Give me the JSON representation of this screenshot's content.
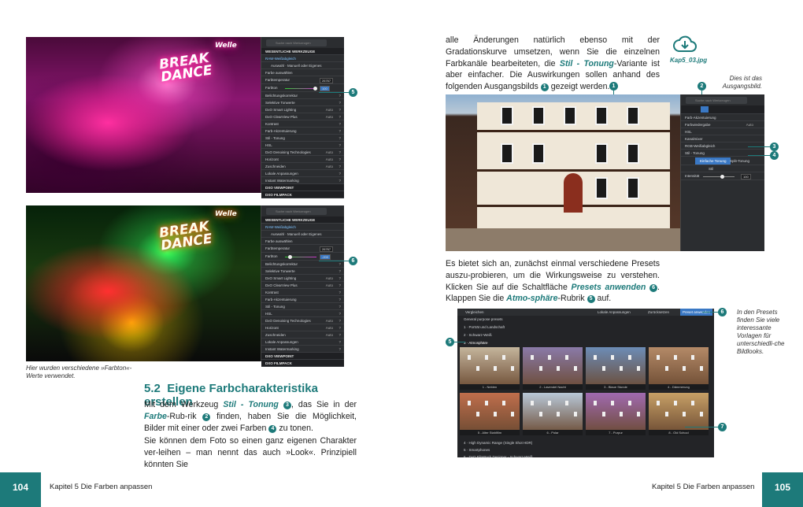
{
  "left_page": {
    "panel": {
      "search_placeholder": "Suche nach Werkzeugen",
      "section": "WESENTLICHE WERKZEUGE",
      "sub": "RAW-Weißabgleich",
      "mode": "Auswahl · Manuell oder Eigenes",
      "pick": "Farbe auswählen",
      "temp_label": "Farbtemperatur",
      "temp_value": "26767",
      "tint_label": "Farbton",
      "tint_value_1": "100",
      "tint_value_2": "-200",
      "tools": [
        "Belichtungskorrektur",
        "Selektive Tonwerte",
        "DxO Smart Lighting",
        "DxO ClearView Plus",
        "Kontrast",
        "Farb-Akzentuierung",
        "Stil - Tonung",
        "HSL",
        "DxO Denoising Technologies",
        "Horizont",
        "Zuschneiden",
        "Lokale Anpassungen",
        "Instant Watermarking"
      ],
      "tool_values": [
        "",
        "",
        "Auto",
        "Auto",
        "",
        "",
        "",
        "",
        "Auto",
        "Auto",
        "Auto",
        "",
        ""
      ],
      "footer1": "DXO VIEWPOINT",
      "footer2": "DXO FILMPACK"
    },
    "photo1_sign": "BREAK DANCE",
    "photo1_sub": "Welle",
    "callout_5": "5",
    "callout_6": "6",
    "caption": "Hier wurden verschiedene »Farbton«-Werte verwendet.",
    "heading_num": "5.2",
    "heading": "Eigene Farbcharakteristika erstellen",
    "para1_a": "Mit dem Werkzeug ",
    "para1_tool": "Stil - Tonung",
    "para1_n1": "3",
    "para1_b": ", das Sie in der ",
    "para1_farbe": "Farbe",
    "para1_c": "-Rub-rik ",
    "para1_n2": "2",
    "para1_d": " finden, haben Sie die Möglichkeit, Bilder mit einer oder zwei Farben ",
    "para1_n3": "4",
    "para1_e": " zu tonen.",
    "para2": "Sie können dem Foto so einen ganz eigenen Charakter ver-leihen – man nennt das auch »Look«. Prinzipiell könnten Sie",
    "page_num": "104",
    "footer_label": "Kapitel 5   Die Farben anpassen"
  },
  "right_page": {
    "para_top_a": "alle Änderungen natürlich ebenso mit der Gradationskurve umsetzen, wenn Sie die einzelnen Farbkanäle bearbeiteten, die ",
    "para_top_tool": "Stil - Tonung",
    "para_top_b": "-Variante ist aber einfacher. Die Auswirkungen sollen anhand des folgenden Ausgangsbilds ",
    "para_top_n1": "1",
    "para_top_c": " gezeigt werden.",
    "download_label": "Kap5_03.jpg",
    "side_caption1": "Dies ist das Ausgangsbild.",
    "house_panel": {
      "rows": [
        "Farb-Akzentuierung",
        "Farbwiedergabe",
        "HSL",
        "Kanalmixer",
        "RGB-Weißabgleich",
        "Stil - Tonung"
      ],
      "row_values": [
        "",
        "Auto",
        "",
        "",
        "",
        ""
      ],
      "tab1": "Einfache Tonung",
      "tab2": "Split-Tonung",
      "stil": "Stil",
      "intensity": "Intensität",
      "intensity_value": "100"
    },
    "callouts_top": [
      "1",
      "2",
      "3",
      "4"
    ],
    "para_mid_a": "Es bietet sich an, zunächst einmal verschiedene Presets auszu-probieren, um die Wirkungsweise zu verstehen. Klicken Sie auf die Schaltfläche ",
    "para_mid_btn": "Presets anwenden",
    "para_mid_n6": "6",
    "para_mid_b": ". Klappen Sie die ",
    "para_mid_cat": "Atmo-sphäre",
    "para_mid_c": "-Rubrik ",
    "para_mid_n5": "5",
    "para_mid_d": " auf.",
    "side_caption2": "In den Presets finden Sie viele interessante Vorlagen für unterschiedli-che Bildlooks.",
    "presets_panel": {
      "toolbar_left": "Vergleichen",
      "toolbar_mid": "Lokale Anpassungen",
      "toolbar_reset": "Zurücksetzen",
      "toolbar_btn": "Preset anwenden",
      "cat1": "General purpose presets",
      "cat2": "1 · Porträt und Landschaft",
      "cat3": "2 · Schwarz-Weiß",
      "cat4": "3 · Atmosphäre",
      "thumbs": [
        "1 - Neblen",
        "2 - Lavendel Nacht",
        "3 - Blaue Stunde",
        "4 - Dämmerung",
        "5 - Alter Stahlfilm",
        "6 - Polar",
        "7 - Purpur",
        "8 - Old School"
      ],
      "cat5": "4 · High Dynamic Range (Single Shot HDR)",
      "cat6": "5 · Smartphones",
      "cat7": "6 · DxO FilmPack Designer - Schwarz-Weiß"
    },
    "callouts_bottom": [
      "5",
      "6",
      "7"
    ],
    "page_num": "105",
    "footer_label": "Kapitel 5   Die Farben anpassen"
  },
  "colors": {
    "accent": "#1d7a7a"
  }
}
